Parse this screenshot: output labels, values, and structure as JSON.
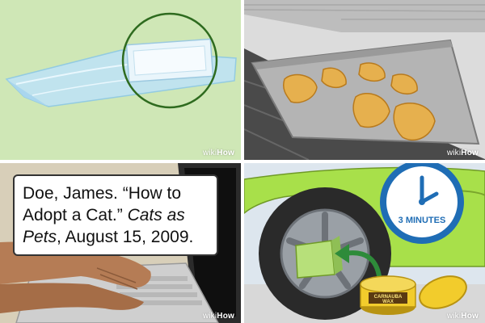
{
  "branding": {
    "prefix": "wiki",
    "suffix": "How"
  },
  "panel_citation": {
    "author": "Doe, James. ",
    "article": "“How to Adopt a Cat.” ",
    "publication": "Cats as Pets",
    "date": ", August 15, 2009."
  },
  "panel_wax": {
    "timer_label": "3 MINUTES",
    "tin_label_line1": "CARNAUBA",
    "tin_label_line2": "WAX"
  },
  "colors": {
    "accent_blue": "#1f6db5",
    "car_green": "#a8e04a",
    "sponge_green": "#b7e07a",
    "tin_yellow": "#f2cc2c",
    "circle_green": "#2e6b1f"
  }
}
